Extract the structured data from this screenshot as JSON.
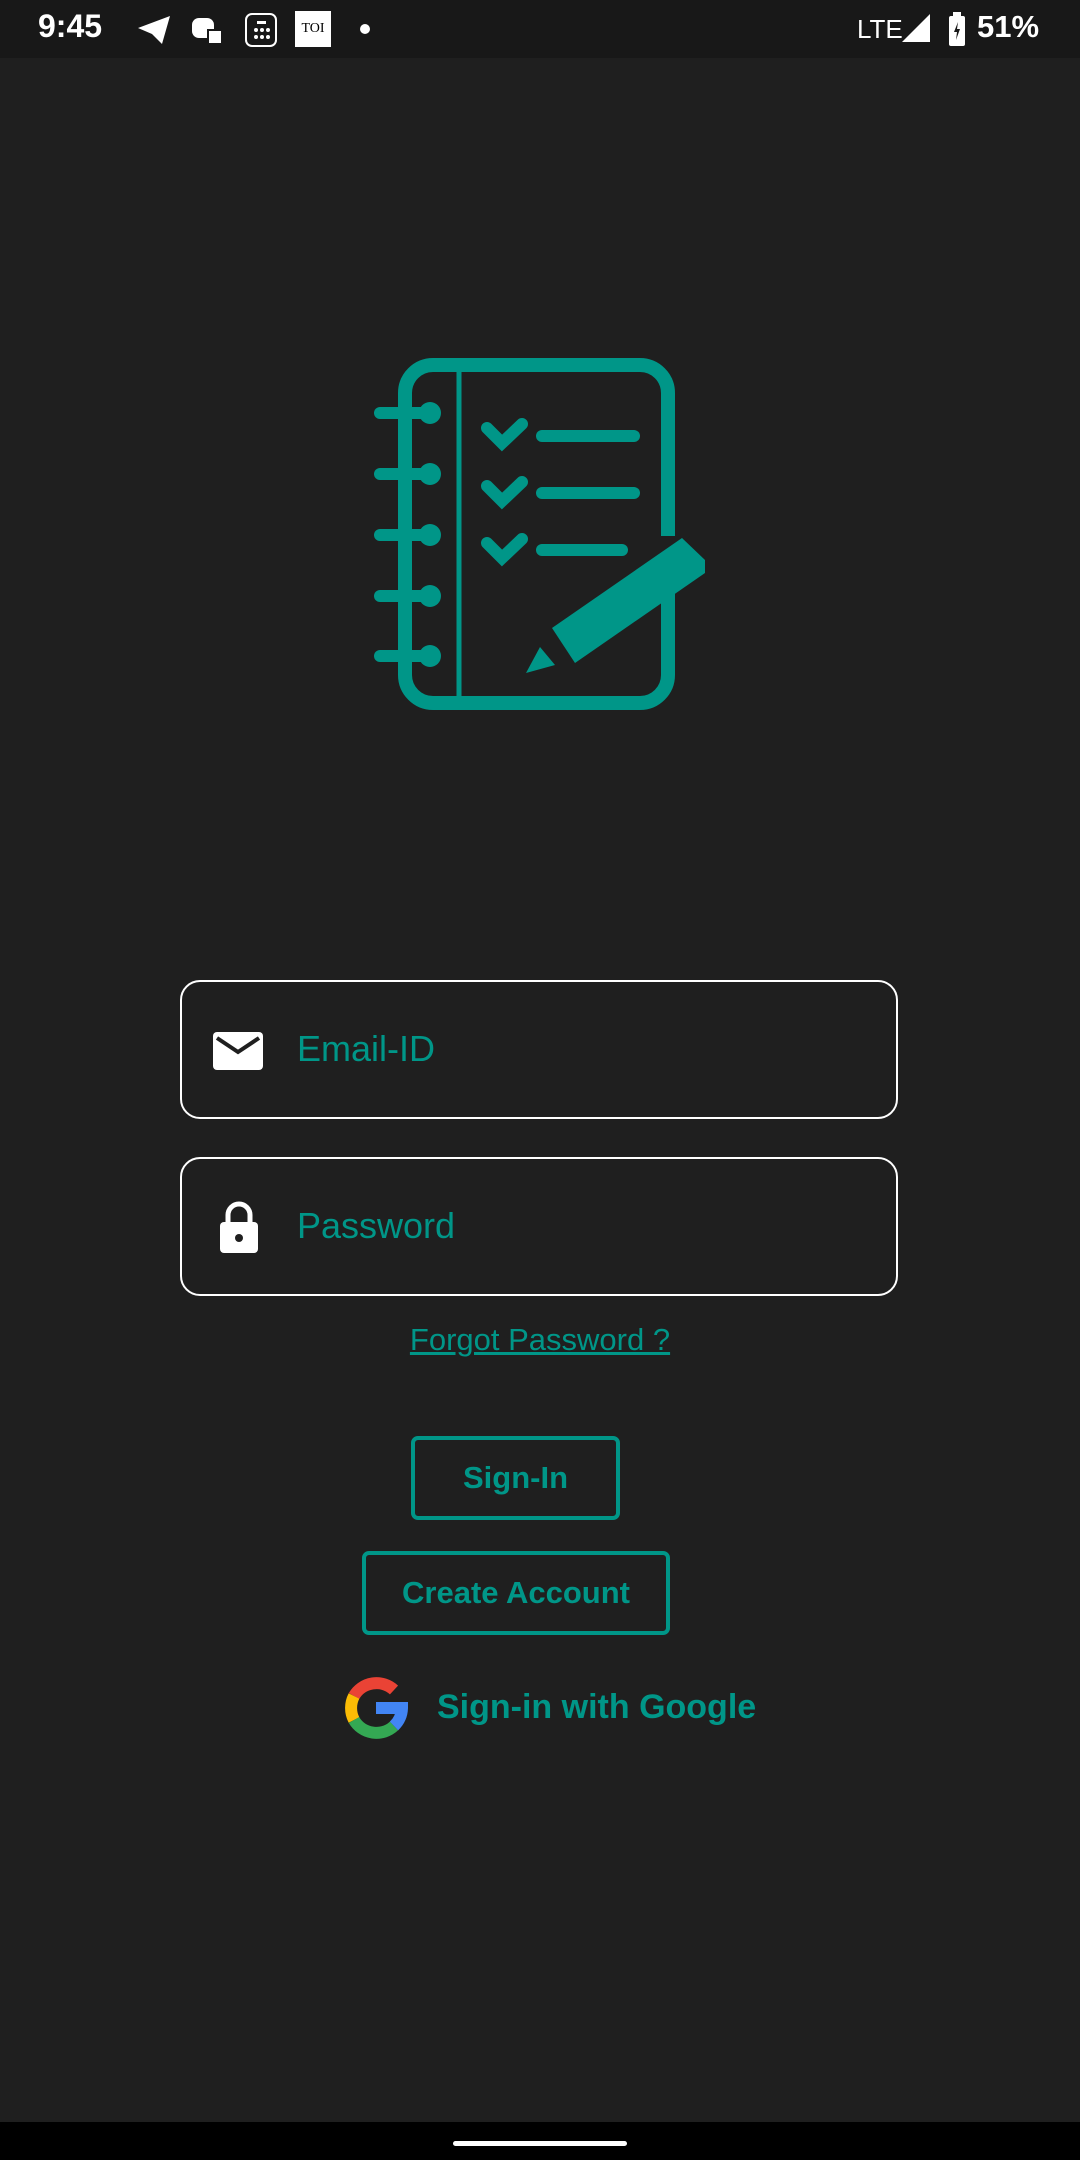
{
  "status_bar": {
    "time": "9:45",
    "network": "LTE",
    "battery": "51%",
    "notif_icons": [
      "telegram-icon",
      "discord-icon",
      "calculator-icon",
      "toi-icon",
      "dot-icon"
    ],
    "toi_label": "TOI"
  },
  "colors": {
    "accent": "#009688",
    "background": "#1f1f1f"
  },
  "login": {
    "email_placeholder": "Email-ID",
    "password_placeholder": "Password",
    "forgot_password": "Forgot Password ?",
    "sign_in": "Sign-In",
    "create_account": "Create Account",
    "google_sign_in": "Sign-in with Google"
  }
}
